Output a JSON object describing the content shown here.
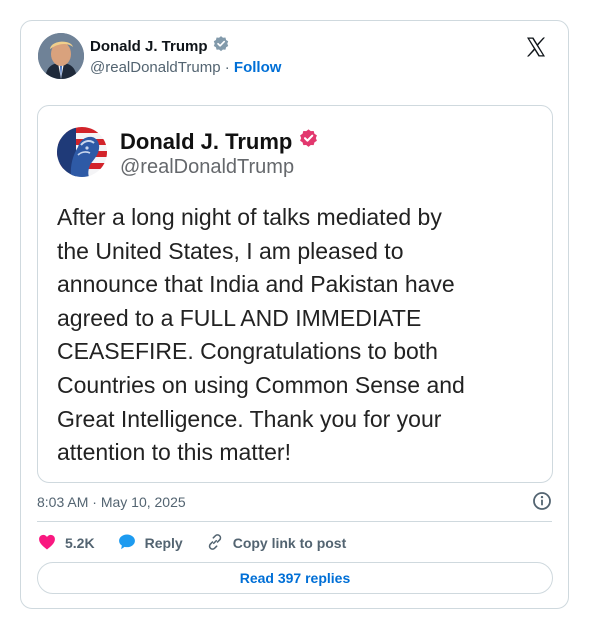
{
  "embed": {
    "author_name": "Donald J. Trump",
    "author_handle": "@realDonaldTrump",
    "separator": "·",
    "follow_label": "Follow",
    "verified_color": "#829aab",
    "link_color": "#006fd6"
  },
  "quoted_post": {
    "author_name": "Donald J. Trump",
    "author_handle": "@realDonaldTrump",
    "verified_color": "#e2386e",
    "text_lines": [
      "After a long night of talks mediated by",
      "the United States, I am pleased to",
      "announce that India and Pakistan have",
      "agreed to a FULL AND IMMEDIATE",
      "CEASEFIRE. Congratulations to both",
      "Countries on using Common Sense and",
      "Great Intelligence. Thank you for your",
      "attention to this matter!"
    ]
  },
  "meta": {
    "time": "8:03 AM",
    "separator": "·",
    "date": "May 10, 2025"
  },
  "actions": {
    "like_count": "5.2K",
    "reply_label": "Reply",
    "copy_label": "Copy link to post",
    "like_color": "#f91880",
    "reply_color": "#1d9bf0"
  },
  "footer": {
    "read_replies_label": "Read 397 replies"
  },
  "icons": {
    "brand": "x-logo-icon",
    "verified": "verified-badge-icon",
    "info": "info-icon",
    "like": "heart-icon",
    "reply": "speech-bubble-icon",
    "copy": "link-icon"
  }
}
